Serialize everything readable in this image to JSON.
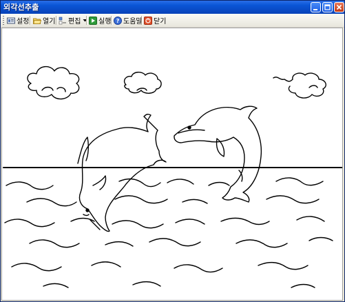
{
  "window": {
    "title": "외각선추출"
  },
  "toolbar": {
    "items": [
      {
        "label": "설정",
        "icon": "settings-icon"
      },
      {
        "label": "열기",
        "icon": "folder-open-icon"
      },
      {
        "label": "편집",
        "icon": "edit-icon",
        "has_dropdown": true
      },
      {
        "label": "실행",
        "icon": "play-icon"
      },
      {
        "label": "도움말",
        "icon": "help-icon"
      },
      {
        "label": "닫기",
        "icon": "close-icon"
      }
    ]
  },
  "canvas": {
    "content": "dolphins line drawing"
  }
}
